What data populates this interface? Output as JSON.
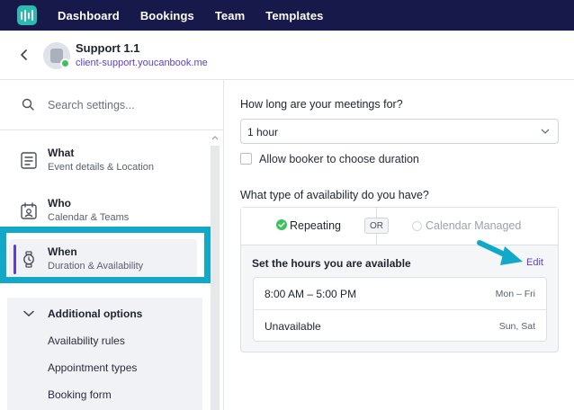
{
  "nav": {
    "items": [
      "Dashboard",
      "Bookings",
      "Team",
      "Templates"
    ]
  },
  "header": {
    "title": "Support 1.1",
    "link": "client-support.youcanbook.me"
  },
  "sidebar": {
    "search_placeholder": "Search settings...",
    "items": [
      {
        "title": "What",
        "subtitle": "Event details & Location",
        "icon": "document-list-icon"
      },
      {
        "title": "Who",
        "subtitle": "Calendar & Teams",
        "icon": "calendar-person-icon"
      },
      {
        "title": "When",
        "subtitle": "Duration & Availability",
        "icon": "watch-icon"
      }
    ],
    "additional": {
      "label": "Additional options",
      "links": [
        "Availability rules",
        "Appointment types",
        "Booking form"
      ]
    }
  },
  "main": {
    "duration_question": "How long are your meetings for?",
    "duration_value": "1 hour",
    "allow_choose_label": "Allow booker to choose duration",
    "availability_question": "What type of availability do you have?",
    "tabs": {
      "repeating": "Repeating",
      "or": "OR",
      "calendar": "Calendar Managed"
    },
    "hours_title": "Set the hours you are available",
    "edit_label": "Edit",
    "hours": [
      {
        "time": "8:00 AM – 5:00 PM",
        "days": "Mon – Fri"
      },
      {
        "time": "Unavailable",
        "days": "Sun, Sat"
      }
    ]
  },
  "colors": {
    "nav_bg": "#16194a",
    "accent": "#5d3fd3",
    "highlight": "#12a9c9",
    "logo": "#2bb9b2",
    "success": "#3ec25e"
  }
}
